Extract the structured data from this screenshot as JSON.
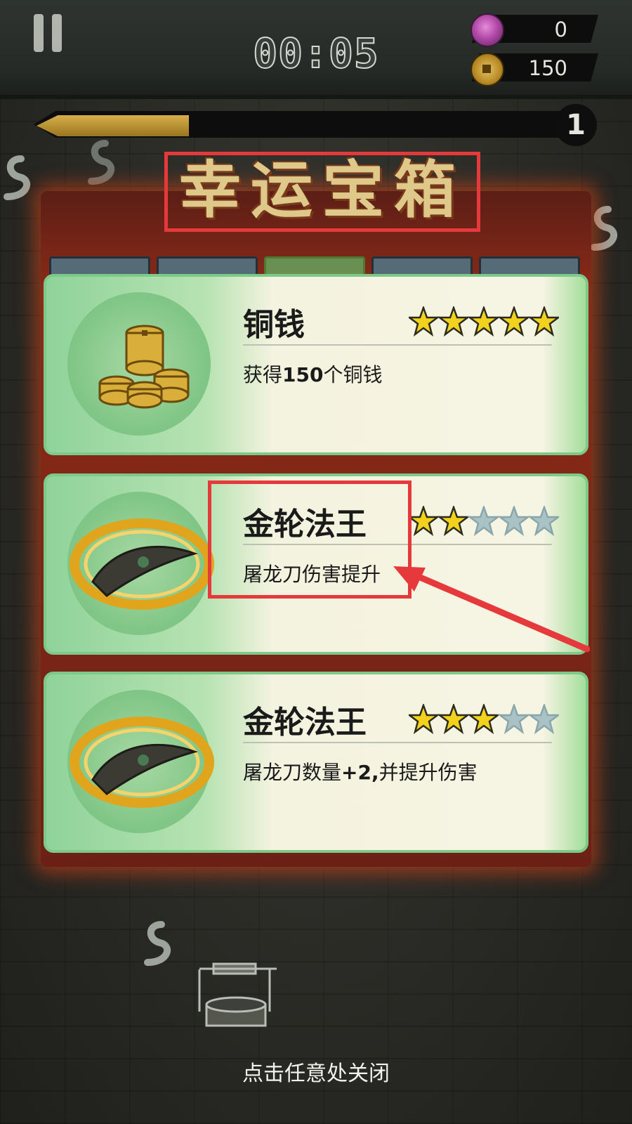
{
  "hud": {
    "timer": "00:05",
    "gems": "0",
    "coins": "150",
    "level": "1",
    "xp_progress": 0.28
  },
  "dialog": {
    "title": "幸运宝箱",
    "close_hint": "点击任意处关闭",
    "cards": [
      {
        "name": "铜钱",
        "desc_prefix": "获得",
        "desc_bold": "150",
        "desc_suffix": "个铜钱",
        "stars": 5,
        "icon": "coin-pile-icon"
      },
      {
        "name": "金轮法王",
        "desc_prefix": "屠龙刀伤害提升",
        "desc_bold": "",
        "desc_suffix": "",
        "stars": 2,
        "icon": "golden-wheel-icon"
      },
      {
        "name": "金轮法王",
        "desc_prefix": "屠龙刀数量",
        "desc_bold": "+2,",
        "desc_suffix": "并提升伤害",
        "stars": 3,
        "icon": "golden-wheel-icon"
      }
    ]
  },
  "colors": {
    "star_filled": "#f2d21c",
    "star_empty": "#a9c2c6",
    "annotation": "#e6393b"
  },
  "icons": [
    "pause-icon",
    "gem-icon",
    "coin-icon",
    "star-icon",
    "arrow-annotation"
  ]
}
